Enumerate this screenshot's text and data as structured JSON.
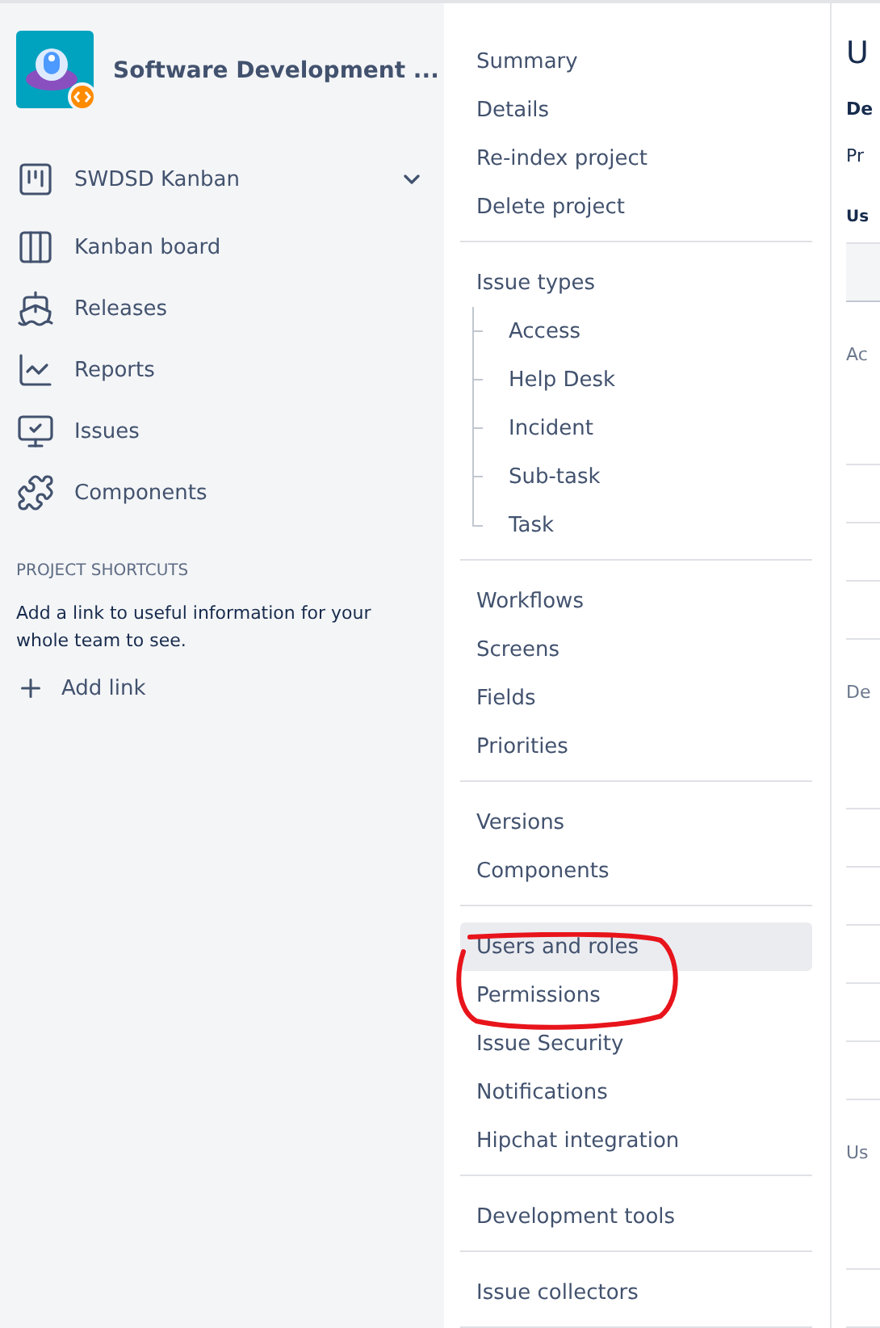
{
  "project": {
    "name": "Software Development ..."
  },
  "board_switcher": {
    "label": "SWDSD Kanban"
  },
  "sidebar": {
    "items": [
      {
        "label": "Kanban board"
      },
      {
        "label": "Releases"
      },
      {
        "label": "Reports"
      },
      {
        "label": "Issues"
      },
      {
        "label": "Components"
      }
    ]
  },
  "shortcuts": {
    "heading": "PROJECT SHORTCUTS",
    "description": "Add a link to useful information for your whole team to see.",
    "add_link": "Add link"
  },
  "settings_nav": {
    "groups": [
      {
        "items": [
          {
            "label": "Summary",
            "selected": false
          },
          {
            "label": "Details",
            "selected": false
          },
          {
            "label": "Re-index project",
            "selected": false
          },
          {
            "label": "Delete project",
            "selected": false
          }
        ]
      },
      {
        "items": [
          {
            "label": "Issue types",
            "selected": false,
            "children": [
              {
                "label": "Access",
                "selected": false
              },
              {
                "label": "Help Desk",
                "selected": false
              },
              {
                "label": "Incident",
                "selected": false
              },
              {
                "label": "Sub-task",
                "selected": false
              },
              {
                "label": "Task",
                "selected": false
              }
            ]
          }
        ]
      },
      {
        "items": [
          {
            "label": "Workflows",
            "selected": false
          },
          {
            "label": "Screens",
            "selected": false
          },
          {
            "label": "Fields",
            "selected": false
          },
          {
            "label": "Priorities",
            "selected": false
          }
        ]
      },
      {
        "items": [
          {
            "label": "Versions",
            "selected": false
          },
          {
            "label": "Components",
            "selected": false
          }
        ]
      },
      {
        "items": [
          {
            "label": "Users and roles",
            "selected": true
          },
          {
            "label": "Permissions",
            "selected": false
          },
          {
            "label": "Issue Security",
            "selected": false
          },
          {
            "label": "Notifications",
            "selected": false
          },
          {
            "label": "Hipchat integration",
            "selected": false
          }
        ]
      },
      {
        "items": [
          {
            "label": "Development tools",
            "selected": false
          }
        ]
      },
      {
        "items": [
          {
            "label": "Issue collectors",
            "selected": false
          }
        ]
      }
    ]
  },
  "content": {
    "title": "U",
    "lines": [
      {
        "kind": "bold",
        "text": "De"
      },
      {
        "kind": "plain",
        "text": "Pr"
      },
      {
        "kind": "label",
        "text": "Us"
      },
      {
        "kind": "header"
      },
      {
        "kind": "muted",
        "text": "Ac"
      },
      {
        "kind": "rows"
      },
      {
        "kind": "muted",
        "text": "De"
      },
      {
        "kind": "rows2"
      },
      {
        "kind": "muted",
        "text": "Us"
      },
      {
        "kind": "rows3"
      }
    ]
  }
}
